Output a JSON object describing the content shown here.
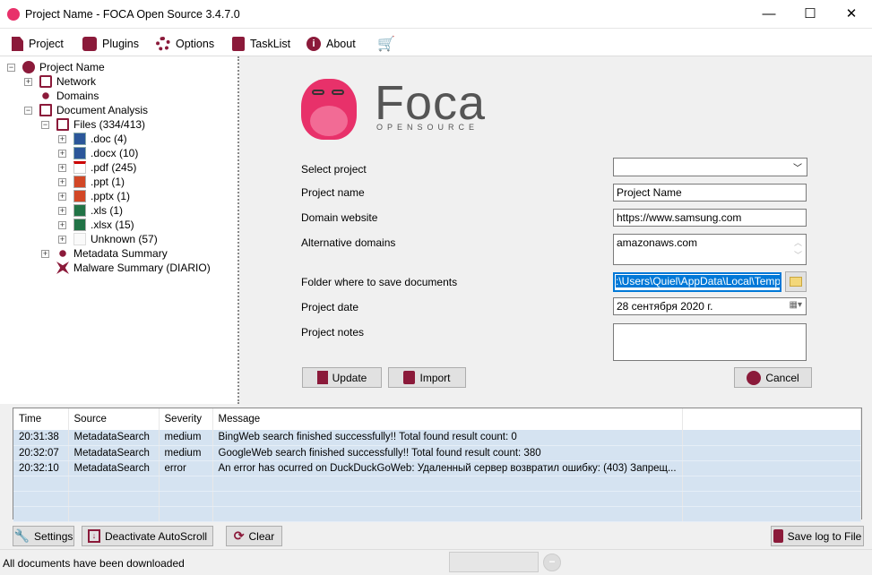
{
  "window": {
    "title": "Project Name - FOCA Open Source 3.4.7.0",
    "minimize": "—",
    "maximize": "☐",
    "close": "✕"
  },
  "menu": [
    {
      "label": "Project",
      "icon": "document-icon"
    },
    {
      "label": "Plugins",
      "icon": "puzzle-icon"
    },
    {
      "label": "Options",
      "icon": "gear-icon"
    },
    {
      "label": "TaskList",
      "icon": "clipboard-icon"
    },
    {
      "label": "About",
      "icon": "info-icon"
    },
    {
      "label": "",
      "icon": "cart-icon"
    }
  ],
  "tree": [
    {
      "label": "Project Name",
      "level": 0,
      "expander": "−",
      "icon": "globe"
    },
    {
      "label": "Network",
      "level": 1,
      "expander": "+",
      "icon": "monitor"
    },
    {
      "label": "Domains",
      "level": 1,
      "expander": "",
      "icon": "nodes"
    },
    {
      "label": "Document Analysis",
      "level": 1,
      "expander": "−",
      "icon": "docs"
    },
    {
      "label": "Files (334/413)",
      "level": 2,
      "expander": "−",
      "icon": "docs"
    },
    {
      "label": ".doc (4)",
      "level": 3,
      "expander": "+",
      "icon": "word"
    },
    {
      "label": ".docx (10)",
      "level": 3,
      "expander": "+",
      "icon": "word"
    },
    {
      "label": ".pdf (245)",
      "level": 3,
      "expander": "+",
      "icon": "pdf"
    },
    {
      "label": ".ppt (1)",
      "level": 3,
      "expander": "+",
      "icon": "ppt"
    },
    {
      "label": ".pptx (1)",
      "level": 3,
      "expander": "+",
      "icon": "ppt"
    },
    {
      "label": ".xls (1)",
      "level": 3,
      "expander": "+",
      "icon": "excel"
    },
    {
      "label": ".xlsx (15)",
      "level": 3,
      "expander": "+",
      "icon": "excel"
    },
    {
      "label": "Unknown (57)",
      "level": 3,
      "expander": "+",
      "icon": "blank"
    },
    {
      "label": "Metadata Summary",
      "level": 2,
      "expander": "+",
      "icon": "nodes"
    },
    {
      "label": "Malware Summary (DIARIO)",
      "level": 2,
      "expander": "",
      "icon": "malware"
    }
  ],
  "logo": {
    "name": "Foca",
    "sub": "OPENSOURCE"
  },
  "form": {
    "select_project_label": "Select project",
    "select_project_value": "",
    "project_name_label": "Project name",
    "project_name_value": "Project Name",
    "domain_label": "Domain website",
    "domain_value": "https://www.samsung.com",
    "alt_domains_label": "Alternative domains",
    "alt_domains_value": "amazonaws.com",
    "folder_label": "Folder where to save documents",
    "folder_value": ":\\Users\\Quiel\\AppData\\Local\\Temp\\",
    "date_label": "Project date",
    "date_value": "28 сентября 2020 г.",
    "notes_label": "Project notes",
    "notes_value": "",
    "update": "Update",
    "import": "Import",
    "cancel": "Cancel"
  },
  "log": {
    "columns": [
      "Time",
      "Source",
      "Severity",
      "Message"
    ],
    "rows": [
      [
        "20:31:38",
        "MetadataSearch",
        "medium",
        "BingWeb search finished successfully!! Total found result count: 0"
      ],
      [
        "20:32:07",
        "MetadataSearch",
        "medium",
        "GoogleWeb search finished successfully!! Total found result count: 380"
      ],
      [
        "20:32:10",
        "MetadataSearch",
        "error",
        "An error has ocurred on DuckDuckGoWeb: Удаленный сервер возвратил ошибку: (403) Запрещ..."
      ]
    ]
  },
  "buttons": {
    "settings": "Settings",
    "autoscroll": "Deactivate AutoScroll",
    "clear": "Clear",
    "save_log": "Save log to File"
  },
  "status": {
    "text": "All documents have been downloaded"
  },
  "colors": {
    "accent": "#8b1a3a",
    "row": "#d5e3f1",
    "selection": "#0078d7"
  }
}
